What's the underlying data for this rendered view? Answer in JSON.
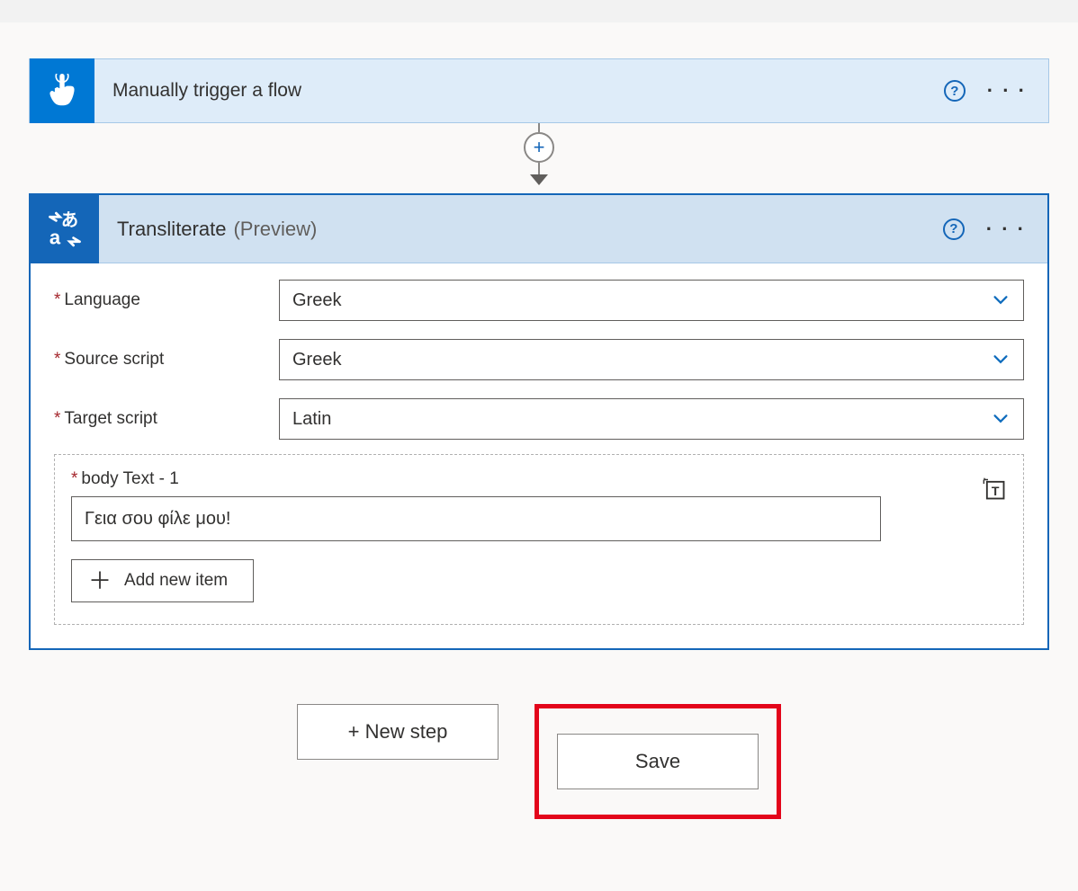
{
  "trigger": {
    "title": "Manually trigger a flow",
    "help_tooltip": "?"
  },
  "action": {
    "title": "Transliterate",
    "subtitle": "(Preview)",
    "help_tooltip": "?",
    "fields": {
      "language": {
        "label": "Language",
        "value": "Greek"
      },
      "source_script": {
        "label": "Source script",
        "value": "Greek"
      },
      "target_script": {
        "label": "Target script",
        "value": "Latin"
      }
    },
    "body": {
      "label": "body Text - 1",
      "value": "Γεια σου φίλε μου!",
      "add_item_label": "Add new item"
    }
  },
  "buttons": {
    "new_step": "+ New step",
    "save": "Save"
  },
  "connector": {
    "plus": "+"
  }
}
